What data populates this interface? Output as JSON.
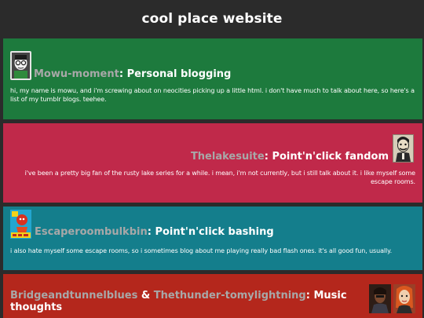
{
  "header": {
    "title": "cool place website"
  },
  "sections": [
    {
      "users": [
        "Mowu-moment"
      ],
      "separator": ": ",
      "topic": "Personal blogging",
      "description": "hi, my name is mowu, and i'm screwing about on neocities picking up a little html. i don't have much to talk about here, so here's a list of my tumblr blogs. teehee.",
      "color": "#1d7a3d",
      "avatars": [
        "mowu-avatar"
      ]
    },
    {
      "users": [
        "Thelakesuite"
      ],
      "separator": ": ",
      "topic": "Point'n'click fandom",
      "description": "i've been a pretty big fan of the rusty lake series for a while. i mean, i'm not currently, but i still talk about it. i like myself some escape rooms.",
      "color": "#c0294a",
      "avatars": [
        "thelakesuite-avatar"
      ]
    },
    {
      "users": [
        "Escaperoombulkbin"
      ],
      "separator": ": ",
      "topic": "Point'n'click bashing",
      "description": "i also hate myself some escape rooms, so i sometimes blog about me playing really bad flash ones. it's all good fun, usually.",
      "color": "#147e8c",
      "avatars": [
        "escaperoombulkbin-avatar"
      ]
    },
    {
      "users": [
        "Bridgeandtunnelblues",
        "Thethunder-tomylightning"
      ],
      "joiner": " & ",
      "separator": ": ",
      "topic": "Music thoughts",
      "color": "#b4271c",
      "avatars": [
        "bridgeandtunnelblues-avatar",
        "thethunder-avatar"
      ]
    }
  ]
}
